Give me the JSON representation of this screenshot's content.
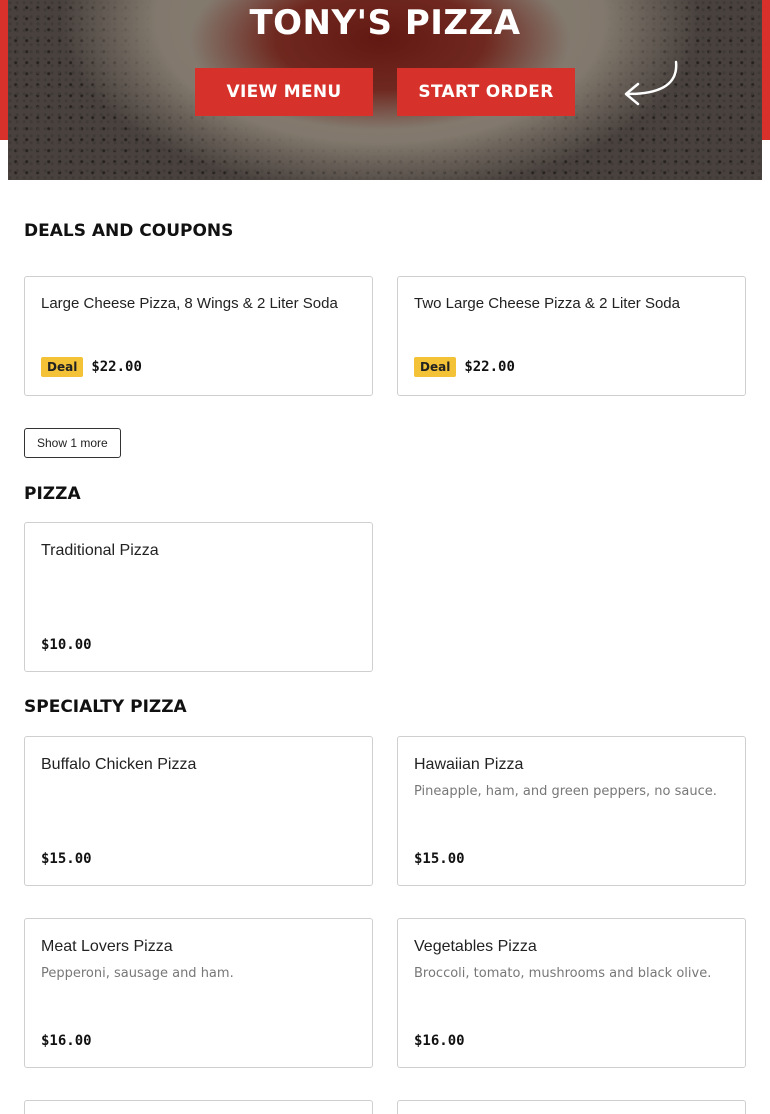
{
  "hero": {
    "title": "TONY'S PIZZA",
    "view_menu_label": "VIEW MENU",
    "start_order_label": "START ORDER",
    "accent_color": "#d6322b"
  },
  "deals": {
    "title": "DEALS AND COUPONS",
    "badge_label": "Deal",
    "items": [
      {
        "name": "Large Cheese Pizza, 8 Wings & 2 Liter Soda",
        "price": "$22.00"
      },
      {
        "name": "Two Large Cheese Pizza & 2 Liter Soda",
        "price": "$22.00"
      }
    ],
    "show_more_label": "Show 1 more",
    "badge_color": "#f3c236"
  },
  "pizza": {
    "title": "PIZZA",
    "items": [
      {
        "name": "Traditional Pizza",
        "price": "$10.00"
      }
    ]
  },
  "specialty": {
    "title": "SPECIALTY PIZZA",
    "items": [
      {
        "name": "Buffalo Chicken Pizza",
        "description": "",
        "price": "$15.00"
      },
      {
        "name": "Hawaiian Pizza",
        "description": "Pineapple, ham, and green peppers, no sauce.",
        "price": "$15.00"
      },
      {
        "name": "Meat Lovers Pizza",
        "description": "Pepperoni, sausage and ham.",
        "price": "$16.00"
      },
      {
        "name": "Vegetables Pizza",
        "description": "Broccoli, tomato, mushrooms and black olive.",
        "price": "$16.00"
      }
    ]
  }
}
